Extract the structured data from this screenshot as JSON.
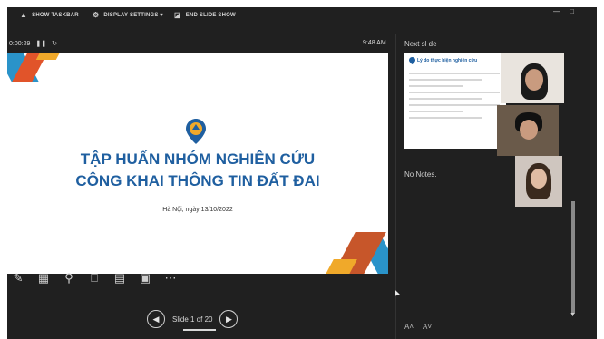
{
  "toolbar": {
    "show_taskbar": "SHOW TASKBAR",
    "display_settings": "DISPLAY SETTINGS ▾",
    "end_slide_show": "END SLIDE SHOW"
  },
  "timer": {
    "elapsed": "0:00:29",
    "pause_icon": "pause-icon",
    "reset_icon": "reset-icon"
  },
  "clock": "9:48 AM",
  "slide": {
    "title_line1": "TẬP HUẤN NHÓM NGHIÊN CỨU",
    "title_line2": "CÔNG KHAI THÔNG TIN ĐẤT ĐAI",
    "subtitle": "Hà Nội, ngày 13/10/2022"
  },
  "navigation": {
    "counter": "Slide 1 of 20"
  },
  "next_slide": {
    "label": "Next sl de",
    "heading": "Lý do thực hiện nghiên cứu"
  },
  "notes": {
    "label": "No Notes."
  },
  "font_controls": {
    "increase": "A˄",
    "decrease": "A˅"
  },
  "colors": {
    "background": "#202020",
    "title_blue": "#1f5fa0",
    "accent_orange": "#e1542a",
    "accent_blue": "#2a93c9",
    "accent_yellow": "#f0a92a"
  }
}
